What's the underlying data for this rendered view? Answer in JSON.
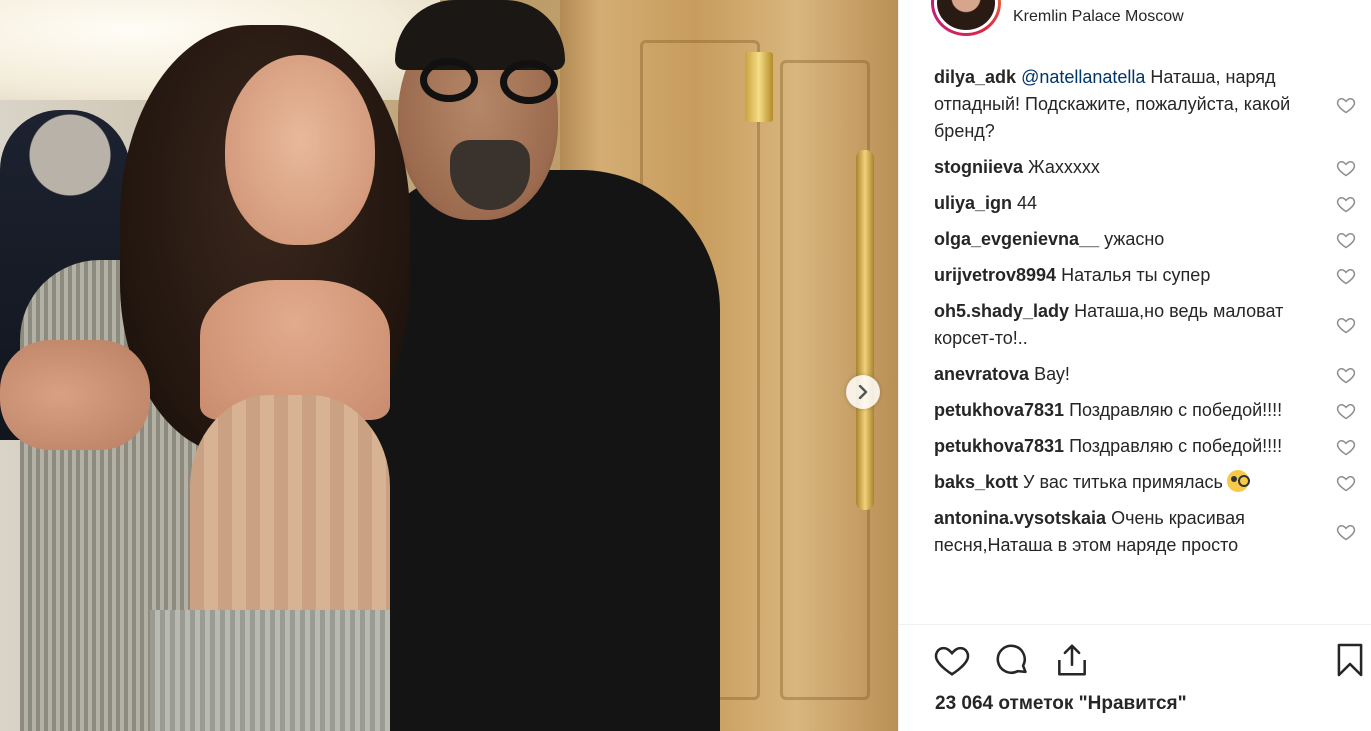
{
  "post": {
    "location": "Kremlin Palace Moscow",
    "likes_text": "23 064 отметок \"Нравится\""
  },
  "comments": [
    {
      "user": "dilya_adk",
      "mention": "@natellanatella",
      "text": " Наташа, наряд отпадный! Подскажите, пожалуйста, какой бренд?"
    },
    {
      "user": "stogniieva",
      "text": " Жахxxxx"
    },
    {
      "user": "uliya_ign",
      "text": " 44"
    },
    {
      "user": "olga_evgenievna__",
      "text": " ужасно"
    },
    {
      "user": "urijvetrov8994",
      "text": " Наталья ты супер"
    },
    {
      "user": "oh5.shady_lady",
      "text": " Наташа,но ведь маловат корсет-то!.."
    },
    {
      "user": "anevratova",
      "text": " Вау!"
    },
    {
      "user": "petukhova7831",
      "text": " Поздравляю с победой!!!!"
    },
    {
      "user": "petukhova7831",
      "text": " Поздравляю с победой!!!!"
    },
    {
      "user": "baks_kott",
      "text": " У вас титька примялась"
    },
    {
      "user": "antonina.vysotskaia",
      "text": " Очень красивая песня,Наташа в этом наряде просто"
    }
  ],
  "icons": {
    "like": "heart-icon",
    "comment": "comment-icon",
    "share": "share-icon",
    "save": "bookmark-icon",
    "next": "chevron-right-icon"
  }
}
